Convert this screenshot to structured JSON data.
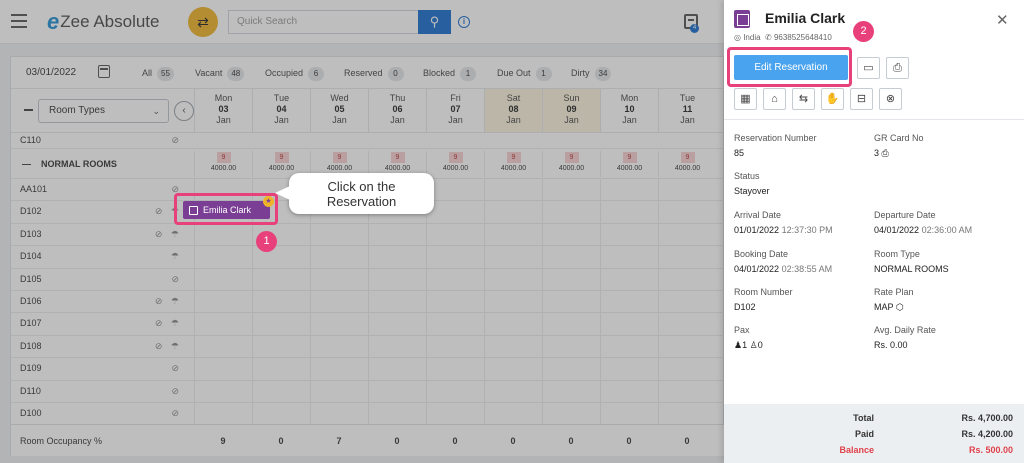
{
  "header": {
    "logo_e": "e",
    "logo_text": "Zee Absolute",
    "search_placeholder": "Quick Search",
    "cal_badge": "4"
  },
  "filters": {
    "date": "03/01/2022",
    "stats": [
      {
        "label": "All",
        "count": "55"
      },
      {
        "label": "Vacant",
        "count": "48"
      },
      {
        "label": "Occupied",
        "count": "6"
      },
      {
        "label": "Reserved",
        "count": "0"
      },
      {
        "label": "Blocked",
        "count": "1"
      },
      {
        "label": "Due Out",
        "count": "1"
      },
      {
        "label": "Dirty",
        "count": "34"
      }
    ]
  },
  "grid": {
    "room_type_select": "Room Types",
    "days": [
      {
        "dow": "Mon",
        "day": "03",
        "mon": "Jan"
      },
      {
        "dow": "Tue",
        "day": "04",
        "mon": "Jan"
      },
      {
        "dow": "Wed",
        "day": "05",
        "mon": "Jan"
      },
      {
        "dow": "Thu",
        "day": "06",
        "mon": "Jan"
      },
      {
        "dow": "Fri",
        "day": "07",
        "mon": "Jan"
      },
      {
        "dow": "Sat",
        "day": "08",
        "mon": "Jan"
      },
      {
        "dow": "Sun",
        "day": "09",
        "mon": "Jan"
      },
      {
        "dow": "Mon",
        "day": "10",
        "mon": "Jan"
      },
      {
        "dow": "Tue",
        "day": "11",
        "mon": "Jan"
      }
    ],
    "prev_room": "C110",
    "category": {
      "name": "NORMAL ROOMS",
      "avail": [
        "9",
        "9",
        "9",
        "9",
        "9",
        "9",
        "9",
        "9",
        "9"
      ],
      "price": [
        "4000.00",
        "4000.00",
        "4000.00",
        "4000.00",
        "4000.00",
        "4000.00",
        "4000.00",
        "4000.00",
        "4000.00"
      ]
    },
    "rooms": [
      "AA101",
      "D102",
      "D103",
      "D104",
      "D105",
      "D106",
      "D107",
      "D108",
      "D109",
      "D110",
      "D100"
    ],
    "occupancy_label": "Room Occupancy %",
    "occupancy": [
      "9",
      "0",
      "7",
      "0",
      "0",
      "0",
      "0",
      "0",
      "0"
    ],
    "reservation": "Emilia Clark"
  },
  "callout": {
    "step1": "1",
    "step2": "2",
    "text_line1": "Click on the",
    "text_line2": "Reservation"
  },
  "panel": {
    "guest_name": "Emilia Clark",
    "country": "India",
    "phone": "9638525648410",
    "edit_button": "Edit Reservation",
    "fields": {
      "reservation_number_label": "Reservation Number",
      "reservation_number": "85",
      "gr_card_label": "GR Card No",
      "gr_card": "3",
      "status_label": "Status",
      "status": "Stayover",
      "arrival_label": "Arrival Date",
      "arrival_date": "01/01/2022",
      "arrival_time": "12:37:30 PM",
      "departure_label": "Departure Date",
      "departure_date": "04/01/2022",
      "departure_time": "02:36:00 AM",
      "booking_label": "Booking Date",
      "booking_date": "04/01/2022",
      "booking_time": "02:38:55 AM",
      "room_type_label": "Room Type",
      "room_type": "NORMAL ROOMS",
      "room_number_label": "Room Number",
      "room_number": "D102",
      "rate_plan_label": "Rate Plan",
      "rate_plan": "MAP",
      "pax_label": "Pax",
      "pax_adult": "1",
      "pax_child": "0",
      "adr_label": "Avg. Daily Rate",
      "adr": "Rs. 0.00"
    },
    "totals": {
      "total_label": "Total",
      "total": "Rs. 4,700.00",
      "paid_label": "Paid",
      "paid": "Rs. 4,200.00",
      "balance_label": "Balance",
      "balance": "Rs. 500.00"
    }
  }
}
